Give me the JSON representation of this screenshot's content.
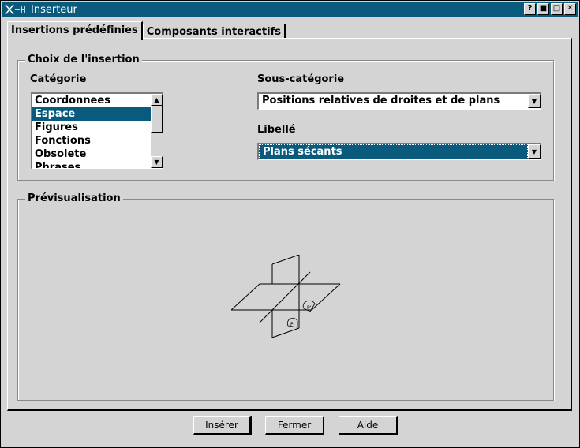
{
  "window": {
    "title": "Inserteur"
  },
  "titlebar_buttons": [
    "?",
    "■",
    "□",
    "✕"
  ],
  "tabs": [
    {
      "label": "Insertions prédéfinies",
      "active": true
    },
    {
      "label": "Composants interactifs",
      "active": false
    }
  ],
  "choice_group": {
    "title": "Choix de l'insertion",
    "category_label": "Catégorie",
    "categories": [
      "Coordonnees",
      "Espace",
      "Figures",
      "Fonctions",
      "Obsolete",
      "Phrases"
    ],
    "selected_category": "Espace",
    "subcategory_label": "Sous-catégorie",
    "subcategory_value": "Positions relatives de droites et de plans",
    "libelle_label": "Libellé",
    "libelle_value": "Plans sécants"
  },
  "preview_group": {
    "title": "Prévisualisation",
    "figure_labels": {
      "p": "P",
      "p2": "P'"
    }
  },
  "buttons": {
    "insert": "Insérer",
    "close": "Fermer",
    "help": "Aide"
  },
  "colors": {
    "titlebar": "#0a5a7e",
    "selection": "#0a5a7e",
    "background": "#d4d4d4"
  }
}
